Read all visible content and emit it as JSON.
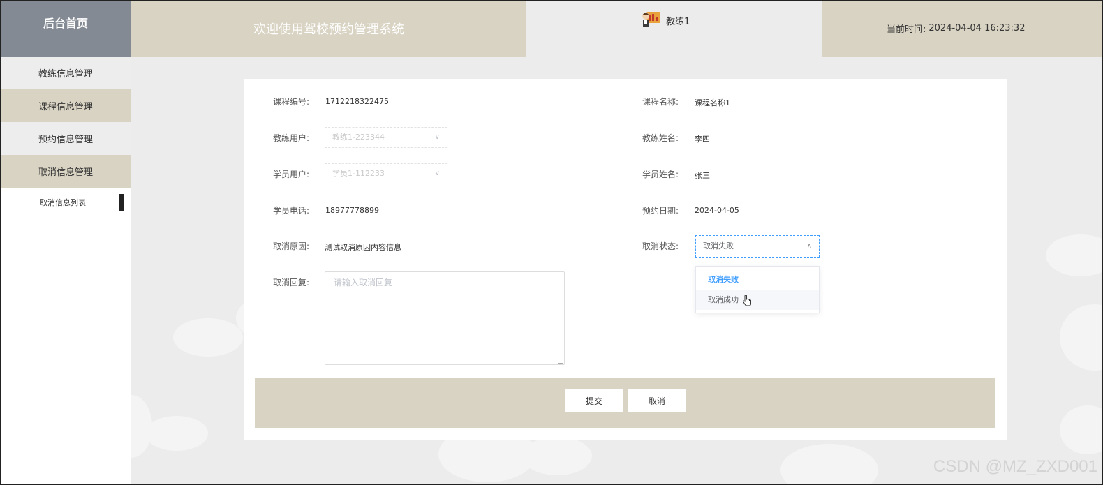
{
  "header": {
    "home": "后台首页",
    "welcome": "欢迎使用驾校预约管理系统",
    "username": "教练1",
    "time_label": "当前时间:",
    "time_value": "2024-04-04 16:23:32"
  },
  "sidebar": {
    "items": [
      {
        "label": "教练信息管理"
      },
      {
        "label": "课程信息管理"
      },
      {
        "label": "预约信息管理"
      },
      {
        "label": "取消信息管理"
      }
    ],
    "subitem": "取消信息列表"
  },
  "form": {
    "course_no_label": "课程编号:",
    "course_no": "1712218322475",
    "course_name_label": "课程名称:",
    "course_name": "课程名称1",
    "coach_user_label": "教练用户:",
    "coach_user": "教练1-223344",
    "coach_name_label": "教练姓名:",
    "coach_name": "李四",
    "student_user_label": "学员用户:",
    "student_user": "学员1-112233",
    "student_name_label": "学员姓名:",
    "student_name": "张三",
    "student_phone_label": "学员电话:",
    "student_phone": "18977778899",
    "appt_date_label": "预约日期:",
    "appt_date": "2024-04-05",
    "cancel_reason_label": "取消原因:",
    "cancel_reason": "测试取消原因内容信息",
    "cancel_status_label": "取消状态:",
    "cancel_status": "取消失败",
    "cancel_reply_label": "取消回复:",
    "cancel_reply_placeholder": "请输入取消回复"
  },
  "dropdown": {
    "options": [
      "取消失败",
      "取消成功"
    ]
  },
  "buttons": {
    "submit": "提交",
    "cancel": "取消"
  },
  "watermark": "CSDN @MZ_ZXD001",
  "colors": {
    "tan": "#d9d3c3",
    "slate": "#848a93",
    "accent": "#409eff"
  }
}
